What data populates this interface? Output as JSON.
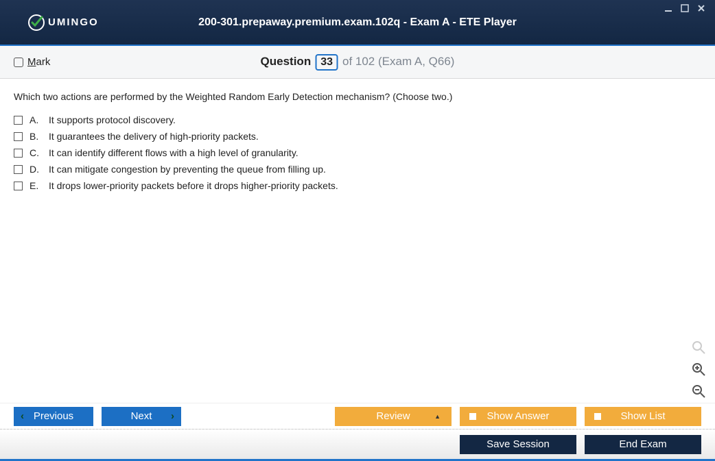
{
  "app": {
    "brand": "UMINGO",
    "title": "200-301.prepaway.premium.exam.102q - Exam A - ETE Player"
  },
  "infobar": {
    "mark_letter_u": "M",
    "mark_rest": "ark",
    "question_word": "Question",
    "question_number": "33",
    "question_rest": "of 102 (Exam A, Q66)"
  },
  "question": {
    "text": "Which two actions are performed by the Weighted Random Early Detection mechanism? (Choose two.)",
    "answers": [
      {
        "letter": "A.",
        "text": "It supports protocol discovery."
      },
      {
        "letter": "B.",
        "text": "It guarantees the delivery of high-priority packets."
      },
      {
        "letter": "C.",
        "text": "It can identify different flows with a high level of granularity."
      },
      {
        "letter": "D.",
        "text": "It can mitigate congestion by preventing the queue from filling up."
      },
      {
        "letter": "E.",
        "text": "It drops lower-priority packets before it drops higher-priority packets."
      }
    ]
  },
  "buttons": {
    "previous": "Previous",
    "next": "Next",
    "review": "Review",
    "show_answer": "Show Answer",
    "show_list": "Show List",
    "save_session": "Save Session",
    "end_exam": "End Exam"
  }
}
